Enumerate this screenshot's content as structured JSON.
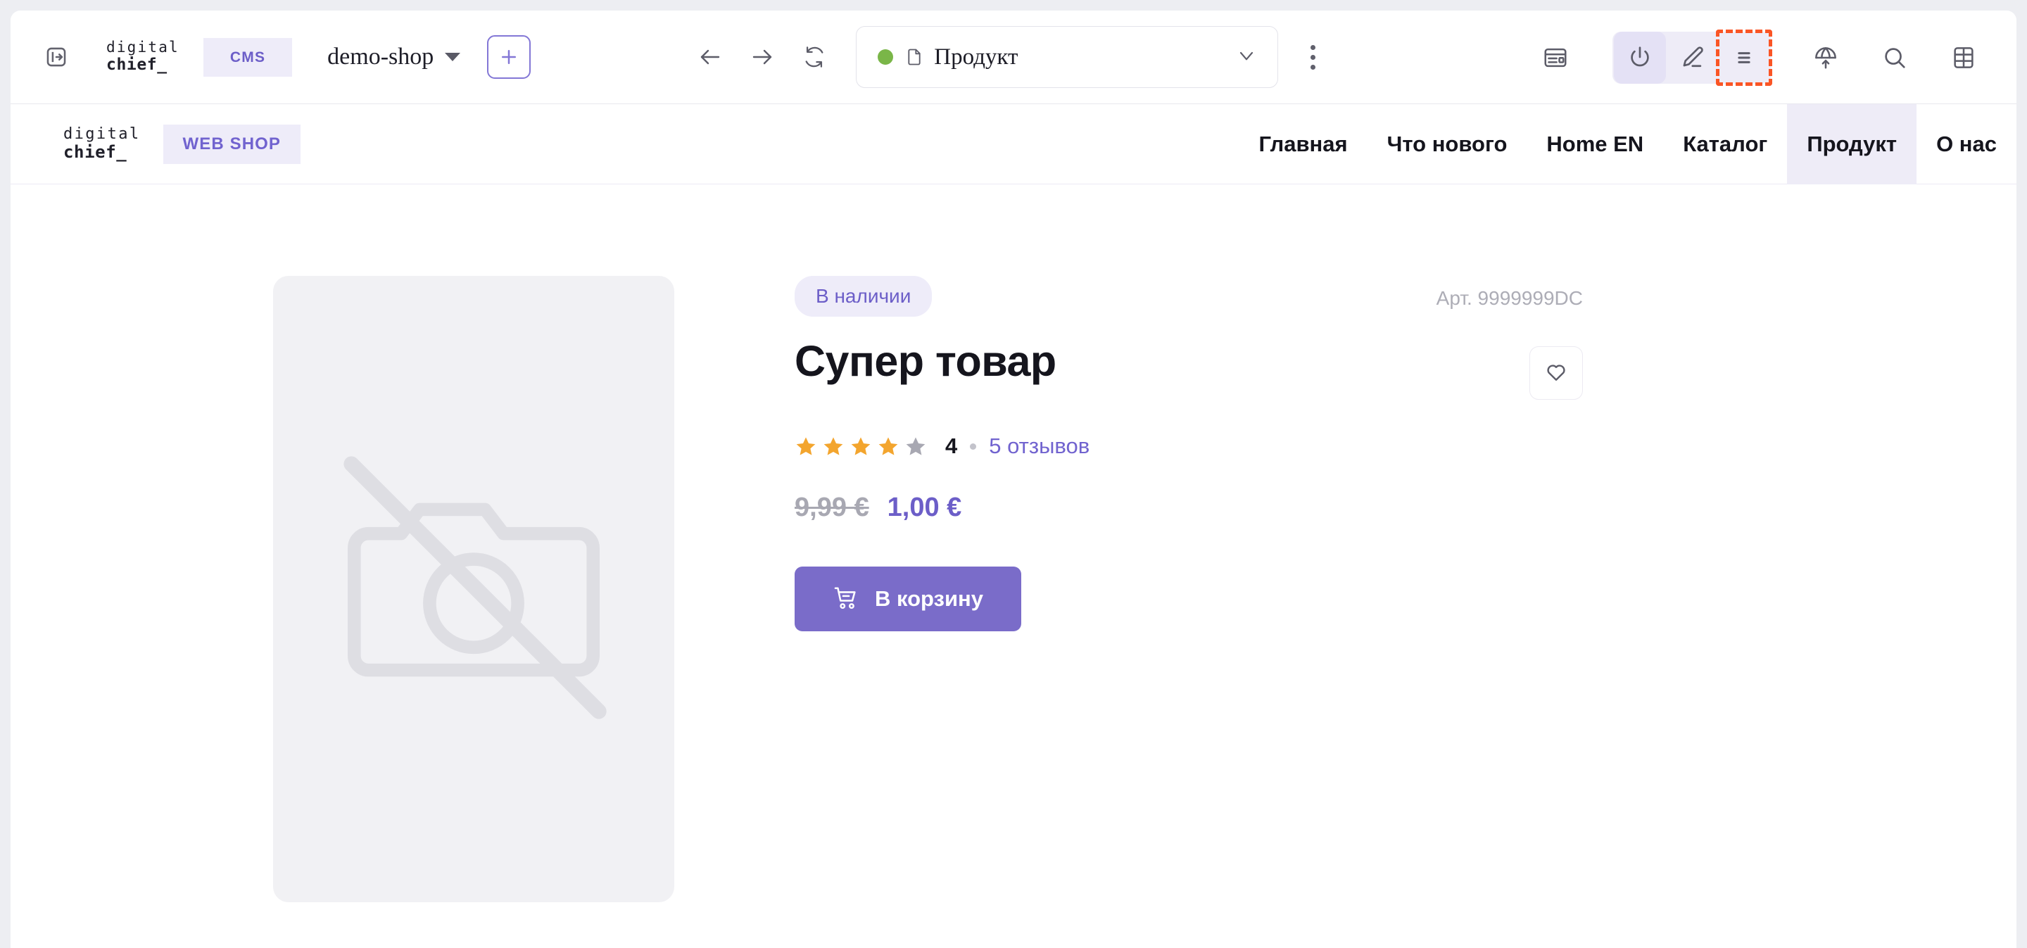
{
  "toolbar": {
    "panel_toggle_icon": "panel-expand-icon",
    "brand_line1": "digital",
    "brand_line2": "chief_",
    "cms_chip": "CMS",
    "shop_name": "demo-shop",
    "add_label": "+",
    "back_icon": "arrow-left-icon",
    "forward_icon": "arrow-right-icon",
    "reload_icon": "reload-icon",
    "page_select": {
      "status": "online",
      "status_color": "#7ab648",
      "label": "Продукт",
      "chevron": "chevron-down-icon"
    },
    "kebab_icon": "more-vertical-icon",
    "right_icons": [
      "layout-icon",
      "power-icon",
      "pencil-icon",
      "list-icon",
      "globe-upload-icon",
      "search-icon",
      "grid-icon"
    ],
    "highlight_color": "#fa5525",
    "active_icon": "power-icon",
    "highlighted_icon": "list-icon"
  },
  "site_header": {
    "brand_line1": "digital",
    "brand_line2": "chief_",
    "shop_chip": "WEB SHOP",
    "nav": [
      {
        "label": "Главная",
        "active": false
      },
      {
        "label": "Что нового",
        "active": false
      },
      {
        "label": "Home EN",
        "active": false
      },
      {
        "label": "Каталог",
        "active": false
      },
      {
        "label": "Продукт",
        "active": true
      },
      {
        "label": "О нас",
        "active": false
      }
    ]
  },
  "product": {
    "gallery_icon": "no-image-camera-icon",
    "availability_badge": "В наличии",
    "sku": "Арт. 9999999DC",
    "title": "Супер товар",
    "favorite_icon": "heart-icon",
    "rating": {
      "stars_filled": 4,
      "stars_total": 5,
      "value": "4",
      "reviews_link": "5 отзывов",
      "star_color": "#f3a52e",
      "star_empty_color": "#a8a8b2"
    },
    "price_old": "9,99 €",
    "price_new": "1,00 €",
    "cart_button": {
      "label": "В корзину",
      "icon": "shopping-cart-icon",
      "color": "#7a6cc9"
    }
  },
  "colors": {
    "accent_purple": "#6c5ec8",
    "chip_bg": "#eeecf9",
    "highlight_orange": "#fa5525",
    "status_green": "#7ab648"
  }
}
